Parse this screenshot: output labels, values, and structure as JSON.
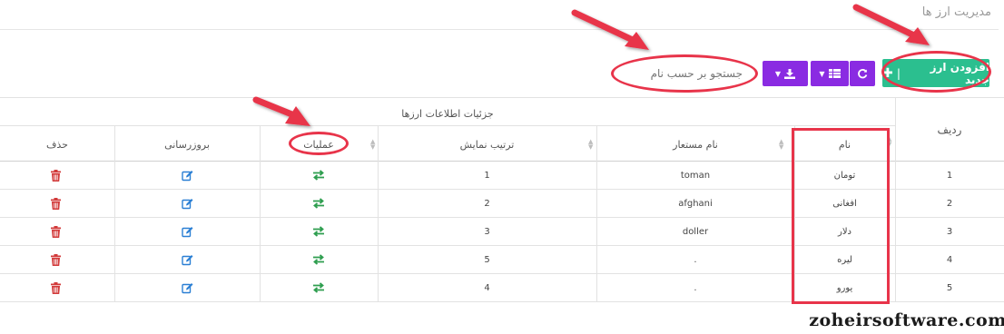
{
  "page": {
    "title": "مدیریت ارز ها"
  },
  "toolbar": {
    "add_label": "افزودن ارز جدید",
    "add_color": "#2bbf8f",
    "purple_color": "#8a2be2",
    "refresh_icon": "refresh-icon",
    "columns_icon": "columns-icon",
    "export_icon": "download-icon"
  },
  "search": {
    "placeholder": "جستجو بر حسب نام"
  },
  "table": {
    "group_header": "جزئیات اطلاعات ارزها",
    "headers": {
      "row": "ردیف",
      "name": "نام",
      "alias": "نام مستعار",
      "order": "ترتیب نمایش",
      "ops": "عملیات",
      "update": "بروزرسانی",
      "delete": "حذف"
    },
    "rows": [
      {
        "row": "1",
        "name": "تومان",
        "alias": "toman",
        "order": "1"
      },
      {
        "row": "2",
        "name": "افغانی",
        "alias": "afghani",
        "order": "2"
      },
      {
        "row": "3",
        "name": "دلار",
        "alias": "doller",
        "order": "3"
      },
      {
        "row": "4",
        "name": "لیره",
        "alias": ".",
        "order": "5"
      },
      {
        "row": "5",
        "name": "یورو",
        "alias": ".",
        "order": "4"
      }
    ],
    "icon_colors": {
      "ops": "#2e9e4f",
      "update": "#2a7fd4",
      "delete": "#d23a3a"
    }
  },
  "annotation_color": "#e8344a",
  "watermark": "zoheirsoftware.com"
}
